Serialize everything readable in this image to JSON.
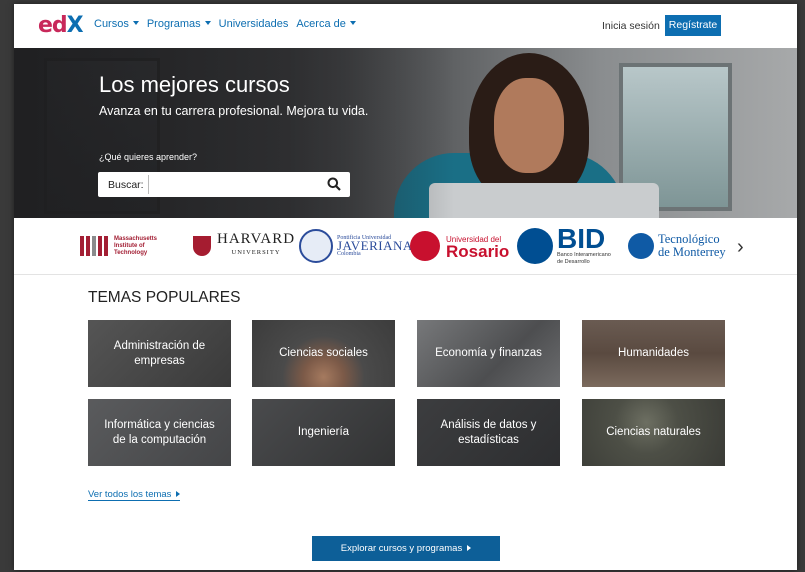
{
  "header": {
    "logo": {
      "ed": "ed",
      "x": "X"
    },
    "nav": [
      {
        "label": "Cursos",
        "dropdown": true
      },
      {
        "label": "Programas",
        "dropdown": true
      },
      {
        "label": "Universidades",
        "dropdown": false
      },
      {
        "label": "Acerca de",
        "dropdown": true
      }
    ],
    "login": "Inicia sesión",
    "register": "Regístrate"
  },
  "hero": {
    "title": "Los mejores cursos",
    "subtitle": "Avanza en tu carrera profesional. Mejora tu vida.",
    "question": "¿Qué quieres aprender?",
    "search_label": "Buscar:",
    "search_value": ""
  },
  "partners": {
    "mit": {
      "line1": "Massachusetts",
      "line2": "Institute of",
      "line3": "Technology"
    },
    "harvard": {
      "name": "HARVARD",
      "sub": "UNIVERSITY"
    },
    "javeriana": {
      "top": "Pontificia Universidad",
      "name": "JAVERIANA",
      "city": "Colombia"
    },
    "rosario": {
      "top": "Universidad del",
      "name": "Rosario"
    },
    "bid": {
      "name": "BID",
      "sub1": "Banco Interamericano",
      "sub2": "de Desarrollo"
    },
    "tec": {
      "line1": "Tecnológico",
      "line2": "de Monterrey"
    }
  },
  "popular": {
    "title": "TEMAS POPULARES",
    "topics": [
      {
        "label": "Administración de empresas"
      },
      {
        "label": "Ciencias sociales"
      },
      {
        "label": "Economía y finanzas"
      },
      {
        "label": "Humanidades"
      },
      {
        "label": "Informática  y ciencias de la computación"
      },
      {
        "label": "Ingeniería"
      },
      {
        "label": "Análisis de datos y estadísticas"
      },
      {
        "label": "Ciencias naturales"
      }
    ],
    "more_link": "Ver todos los temas"
  },
  "cta": "Explorar cursos y programas",
  "colors": {
    "brand_blue": "#0d6eb1",
    "brand_red": "#c8285a"
  }
}
